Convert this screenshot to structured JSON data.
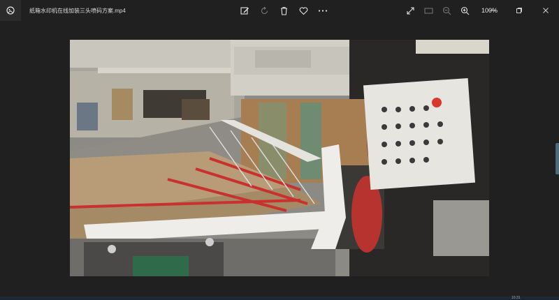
{
  "window": {
    "title": "纸箱水印机在线加装三头喷码方案.mp4"
  },
  "toolbar": {
    "buttons": [
      {
        "name": "edit-button",
        "icon": "edit-image-icon"
      },
      {
        "name": "rotate-button",
        "icon": "rotate-icon"
      },
      {
        "name": "delete-button",
        "icon": "trash-icon"
      },
      {
        "name": "favorite-button",
        "icon": "heart-icon"
      },
      {
        "name": "more-button",
        "icon": "more-icon"
      }
    ]
  },
  "view_controls": {
    "zoom": "100%"
  },
  "taskbar": {
    "clock": "10:31"
  }
}
